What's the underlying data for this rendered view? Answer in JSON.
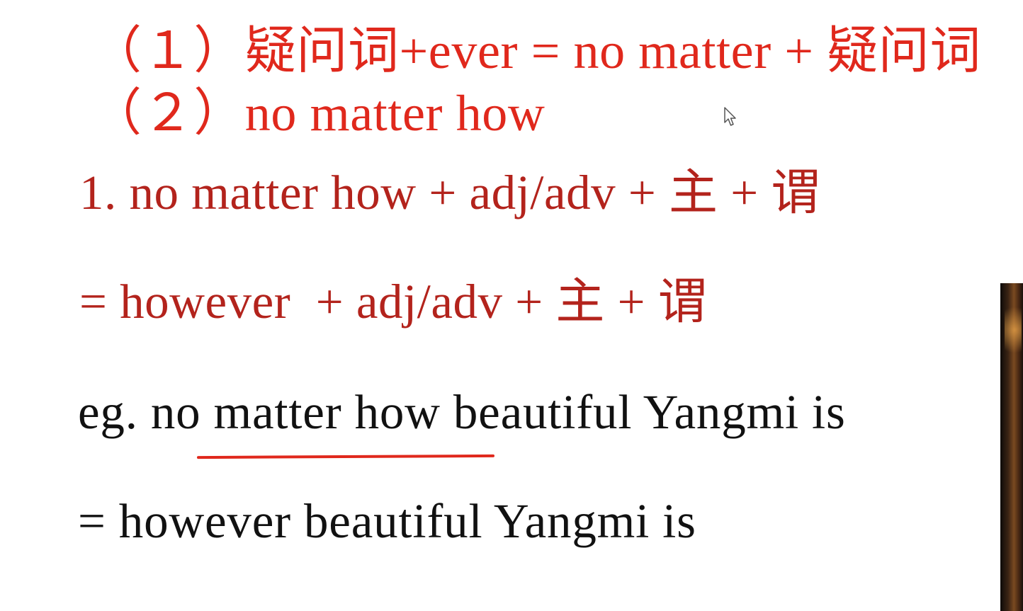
{
  "lesson": {
    "rule_1": "（１）疑问词+ever = no matter + 疑问词",
    "rule_2": "（２）no matter how",
    "formula_1": "1. no matter how + adj/adv + 主 + 谓",
    "formula_2": "= however  + adj/adv + 主 + 谓",
    "example_1": "eg. no matter how beautiful Yangmi is",
    "example_2": "= however beautiful Yangmi is"
  },
  "colors": {
    "rule_red": "#e0281c",
    "formula_red": "#b3231c",
    "example_black": "#111111",
    "underline_red": "#e0281c"
  },
  "icons": {
    "cursor": "mouse-pointer-icon"
  }
}
